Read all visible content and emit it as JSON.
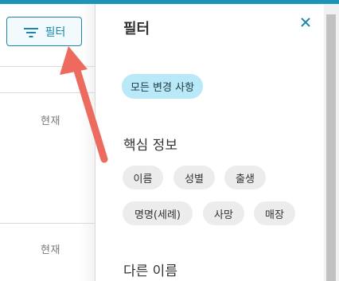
{
  "colors": {
    "accent": "#1b87a8",
    "top_bar": "#1e93b8",
    "chip_active_bg": "#b9e9f8",
    "chip_bg": "#ececec",
    "arrow": "#ec6b5e"
  },
  "toolbar": {
    "filter_label": "필터",
    "filter_icon": "filter-lines-icon"
  },
  "results": {
    "rows": [
      {
        "status": "현재"
      },
      {
        "status": "현재"
      }
    ]
  },
  "filter_panel": {
    "title": "필터",
    "close_icon": "close-icon",
    "all_changes_label": "모든 변경 사항",
    "sections": [
      {
        "heading": "핵심 정보",
        "chips": [
          "이름",
          "성별",
          "출생",
          "명명(세례)",
          "사망",
          "매장"
        ]
      },
      {
        "heading": "다른 이름",
        "chips": []
      }
    ]
  }
}
